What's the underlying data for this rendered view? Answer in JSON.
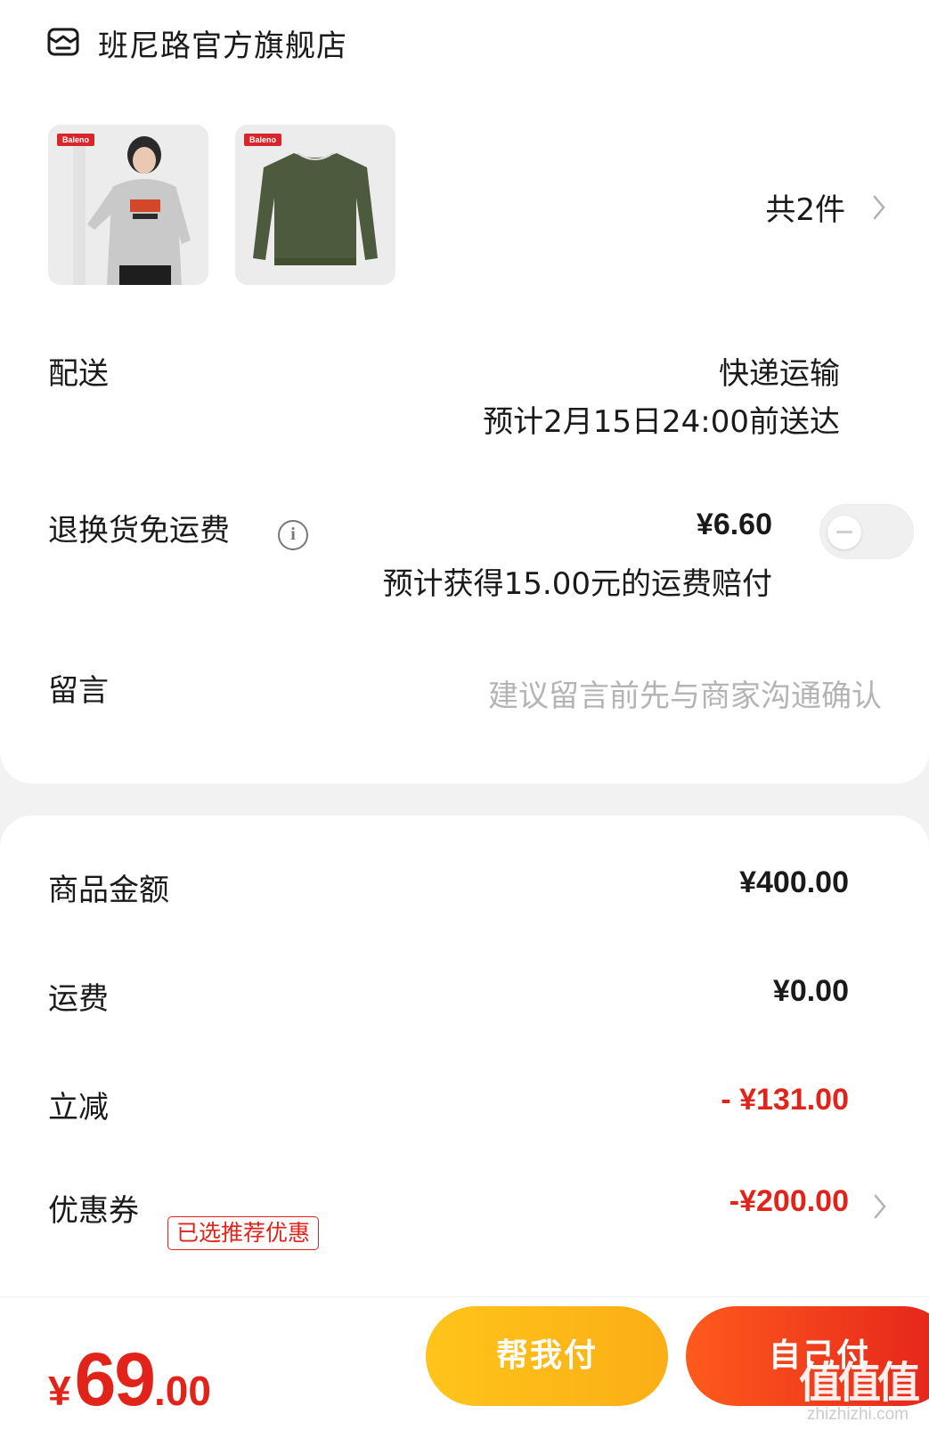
{
  "store": {
    "icon": "store-icon",
    "name": "班尼路官方旗舰店"
  },
  "products": {
    "items": [
      {
        "brand": "Baleno",
        "description": "model wearing grey printed sweatshirt"
      },
      {
        "brand": "Baleno",
        "description": "dark green crewneck sweatshirt"
      }
    ],
    "count_label": "共2件"
  },
  "delivery": {
    "label": "配送",
    "method": "快递运输",
    "eta": "预计2月15日24:00前送达"
  },
  "return_insurance": {
    "label": "退换货免运费",
    "price": "¥6.60",
    "note": "预计获得15.00元的运费赔付",
    "enabled": false
  },
  "message": {
    "label": "留言",
    "placeholder": "建议留言前先与商家沟通确认"
  },
  "summary": {
    "goods_label": "商品金额",
    "goods_value": "¥400.00",
    "shipping_label": "运费",
    "shipping_value": "¥0.00",
    "discount_label": "立减",
    "discount_value": "- ¥131.00",
    "coupon_label": "优惠券",
    "coupon_badge": "已选推荐优惠",
    "coupon_value": "-¥200.00"
  },
  "footer": {
    "currency": "¥",
    "total_int": "69",
    "total_dec": ".00",
    "help_pay_label": "帮我付",
    "self_pay_label": "自己付"
  },
  "watermark": {
    "logo": "值值值",
    "url": "zhizhizhi.com"
  },
  "colors": {
    "accent_red": "#e2231a",
    "help_button": "#fbb516",
    "self_button": "#f03a1c"
  }
}
